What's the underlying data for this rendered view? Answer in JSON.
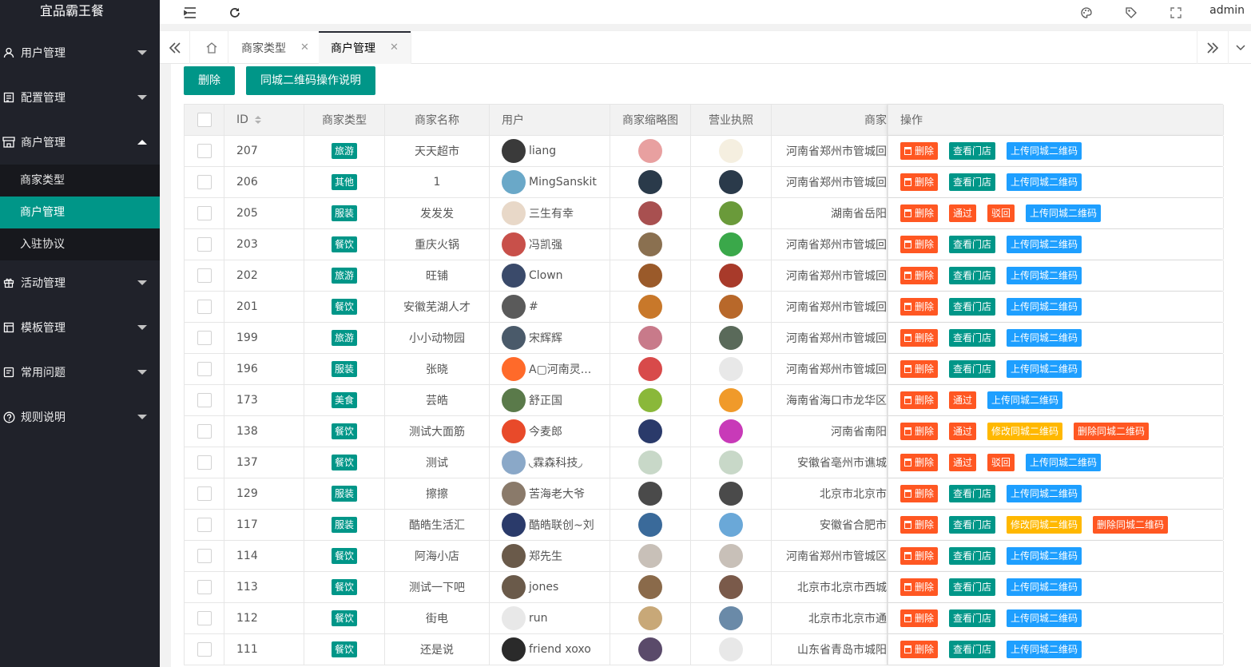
{
  "app": {
    "title": "宜品霸王餐"
  },
  "header": {
    "user": "admin"
  },
  "sidebar": {
    "items": [
      {
        "label": "用户管理",
        "icon": "user-icon",
        "expanded": false
      },
      {
        "label": "配置管理",
        "icon": "config-icon",
        "expanded": false
      },
      {
        "label": "商户管理",
        "icon": "store-icon",
        "expanded": true
      },
      {
        "label": "活动管理",
        "icon": "gift-icon",
        "expanded": false
      },
      {
        "label": "模板管理",
        "icon": "template-icon",
        "expanded": false
      },
      {
        "label": "常用问题",
        "icon": "question-icon",
        "expanded": false
      },
      {
        "label": "规则说明",
        "icon": "help-icon",
        "expanded": false
      }
    ],
    "subitems": [
      {
        "label": "商家类型",
        "active": false
      },
      {
        "label": "商户管理",
        "active": true
      },
      {
        "label": "入驻协议",
        "active": false
      }
    ]
  },
  "tabs": [
    {
      "label": "商家类型",
      "active": false
    },
    {
      "label": "商户管理",
      "active": true
    }
  ],
  "toolbar": {
    "delete_label": "删除",
    "qr_help_label": "同城二维码操作说明"
  },
  "table": {
    "columns": [
      "ID",
      "商家类型",
      "商家名称",
      "用户",
      "商家缩略图",
      "营业执照",
      "商家",
      "操作"
    ],
    "rows": [
      {
        "id": "207",
        "type": "旅游",
        "name": "天天超市",
        "user": "liang",
        "address": "河南省郑州市管城回",
        "avatar": "#3a3a3a",
        "thumb": "#e8a0a0",
        "lic": "#f5efe0",
        "ops": [
          "删除",
          "查看门店",
          "上传同城二维码"
        ]
      },
      {
        "id": "206",
        "type": "其他",
        "name": "1",
        "user": "MingSanskit",
        "address": "河南省郑州市管城回",
        "avatar": "#6aa8c8",
        "thumb": "#2a3a4a",
        "lic": "#2a3a4a",
        "ops": [
          "删除",
          "查看门店",
          "上传同城二维码"
        ]
      },
      {
        "id": "205",
        "type": "服装",
        "name": "发发发",
        "user": "三生有幸",
        "address": "湖南省岳阳",
        "avatar": "#e8d8c8",
        "thumb": "#a85050",
        "lic": "#6a9a3a",
        "ops": [
          "删除",
          "通过",
          "驳回",
          "上传同城二维码"
        ]
      },
      {
        "id": "203",
        "type": "餐饮",
        "name": "重庆火锅",
        "user": "冯凯强",
        "address": "河南省郑州市管城回",
        "avatar": "#c8504a",
        "thumb": "#8a7050",
        "lic": "#3aa84a",
        "ops": [
          "删除",
          "查看门店",
          "上传同城二维码"
        ]
      },
      {
        "id": "202",
        "type": "旅游",
        "name": "旺铺",
        "user": "Clown",
        "address": "河南省郑州市管城回",
        "avatar": "#3a4a6a",
        "thumb": "#9a5a2a",
        "lic": "#a83a2a",
        "ops": [
          "删除",
          "查看门店",
          "上传同城二维码"
        ]
      },
      {
        "id": "201",
        "type": "餐饮",
        "name": "安徽芜湖人才",
        "user": "#",
        "address": "河南省郑州市管城回",
        "avatar": "#5a5a5a",
        "thumb": "#c8782a",
        "lic": "#b8682a",
        "ops": [
          "删除",
          "查看门店",
          "上传同城二维码"
        ]
      },
      {
        "id": "199",
        "type": "旅游",
        "name": "小小动物园",
        "user": "宋辉辉",
        "address": "河南省郑州市管城回",
        "avatar": "#4a5a6a",
        "thumb": "#c87a8a",
        "lic": "#5a6a5a",
        "ops": [
          "删除",
          "查看门店",
          "上传同城二维码"
        ]
      },
      {
        "id": "196",
        "type": "服装",
        "name": "张晓",
        "user": "A▢河南灵...",
        "address": "河南省郑州市管城回",
        "avatar": "#ff6a2a",
        "thumb": "#d84a4a",
        "lic": "#e8e8e8",
        "ops": [
          "删除",
          "查看门店",
          "上传同城二维码"
        ]
      },
      {
        "id": "173",
        "type": "美食",
        "name": "芸皓",
        "user": "舒正国",
        "address": "海南省海口市龙华区",
        "avatar": "#5a7a4a",
        "thumb": "#8ab83a",
        "lic": "#f09a2a",
        "ops": [
          "删除",
          "通过",
          "上传同城二维码"
        ]
      },
      {
        "id": "138",
        "type": "餐饮",
        "name": "测试大面筋",
        "user": "今麦郎",
        "address": "河南省南阳",
        "avatar": "#e84a2a",
        "thumb": "#2a3a6a",
        "lic": "#c83ab8",
        "ops": [
          "删除",
          "通过",
          "修改同城二维码",
          "删除同城二维码"
        ]
      },
      {
        "id": "137",
        "type": "餐饮",
        "name": "测试",
        "user": "◟霖森科技◞",
        "address": "安徽省亳州市谯城",
        "avatar": "#8aa8c8",
        "thumb": "#c8d8c8",
        "lic": "#c8d8c8",
        "ops": [
          "删除",
          "通过",
          "驳回",
          "上传同城二维码"
        ]
      },
      {
        "id": "129",
        "type": "服装",
        "name": "擦擦",
        "user": "苦海老大爷",
        "address": "北京市北京市",
        "avatar": "#8a7a6a",
        "thumb": "#4a4a4a",
        "lic": "#4a4a4a",
        "ops": [
          "删除",
          "查看门店",
          "上传同城二维码"
        ]
      },
      {
        "id": "117",
        "type": "服装",
        "name": "酷皓生活汇",
        "user": "酷皓联创~刘",
        "address": "安徽省合肥市",
        "avatar": "#2a3a6a",
        "thumb": "#3a6a9a",
        "lic": "#6aa8d8",
        "ops": [
          "删除",
          "查看门店",
          "修改同城二维码",
          "删除同城二维码"
        ]
      },
      {
        "id": "114",
        "type": "餐饮",
        "name": "阿海小店",
        "user": "郑先生",
        "address": "河南省郑州市管城区",
        "avatar": "#6a5a4a",
        "thumb": "#c8c0b8",
        "lic": "#c8c0b8",
        "ops": [
          "删除",
          "查看门店",
          "上传同城二维码"
        ]
      },
      {
        "id": "113",
        "type": "餐饮",
        "name": "测试一下吧",
        "user": "jones",
        "address": "北京市北京市西城",
        "avatar": "#6a5a4a",
        "thumb": "#8a6a4a",
        "lic": "#7a5a4a",
        "ops": [
          "删除",
          "查看门店",
          "上传同城二维码"
        ]
      },
      {
        "id": "112",
        "type": "餐饮",
        "name": "街电",
        "user": "run",
        "address": "北京市北京市通",
        "avatar": "#e8e8e8",
        "thumb": "#c8a878",
        "lic": "#6a8aa8",
        "ops": [
          "删除",
          "查看门店",
          "上传同城二维码"
        ]
      },
      {
        "id": "111",
        "type": "餐饮",
        "name": "还是说",
        "user": "friend xoxo",
        "address": "山东省青岛市城阳",
        "avatar": "#2a2a2a",
        "thumb": "#5a4a6a",
        "lic": "#e8e8e8",
        "ops": [
          "删除",
          "查看门店",
          "上传同城二维码"
        ]
      }
    ]
  },
  "colors": {
    "accent": "#009688",
    "danger": "#ff5722",
    "info": "#1e9fff",
    "warn": "#ffb800",
    "sidebar": "#20222a"
  }
}
